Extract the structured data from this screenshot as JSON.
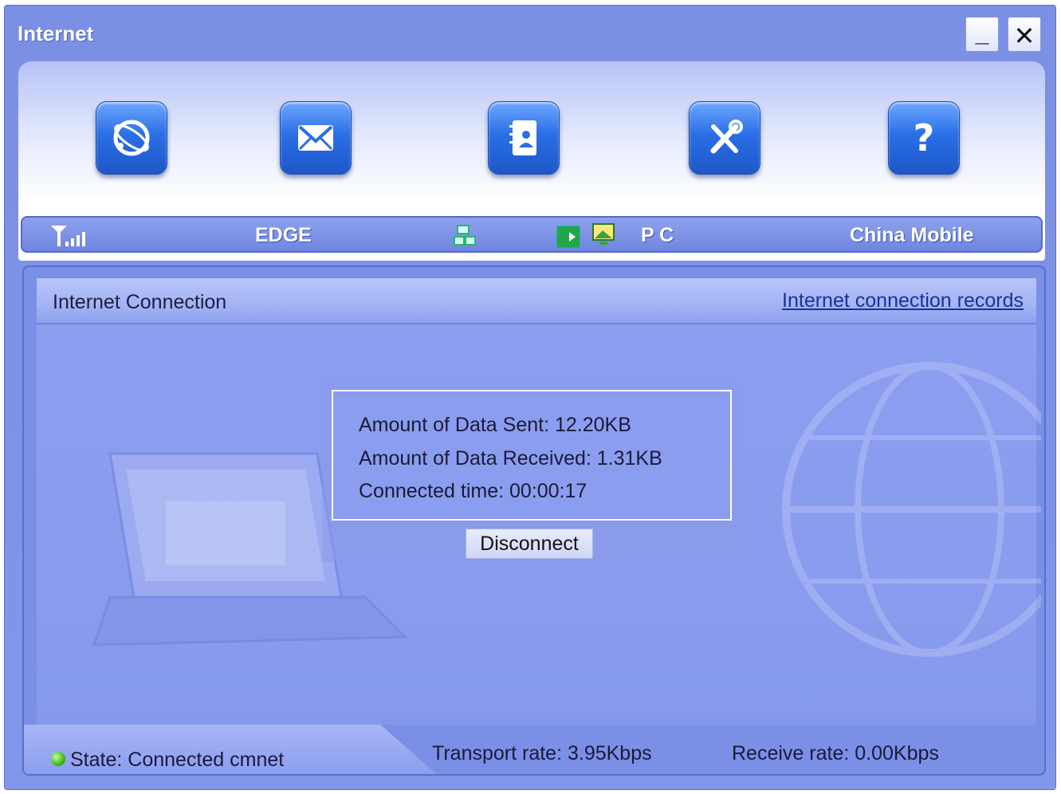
{
  "window": {
    "title": "Internet"
  },
  "toolbar": {
    "buttons": [
      {
        "icon": "internet-icon"
      },
      {
        "icon": "envelope-icon"
      },
      {
        "icon": "contacts-icon"
      },
      {
        "icon": "tools-icon"
      },
      {
        "icon": "help-icon"
      }
    ]
  },
  "status": {
    "network": "EDGE",
    "mode": "P C",
    "operator": "China Mobile"
  },
  "panel": {
    "title": "Internet Connection",
    "records_link": "Internet connection records",
    "data_sent": "Amount of Data Sent: 12.20KB",
    "data_received": "Amount of Data Received: 1.31KB",
    "connected_time": "Connected time: 00:00:17",
    "disconnect_label": "Disconnect"
  },
  "footer": {
    "state": "State: Connected cmnet",
    "transport_rate": "Transport rate: 3.95Kbps",
    "receive_rate": "Receive rate: 0.00Kbps"
  }
}
